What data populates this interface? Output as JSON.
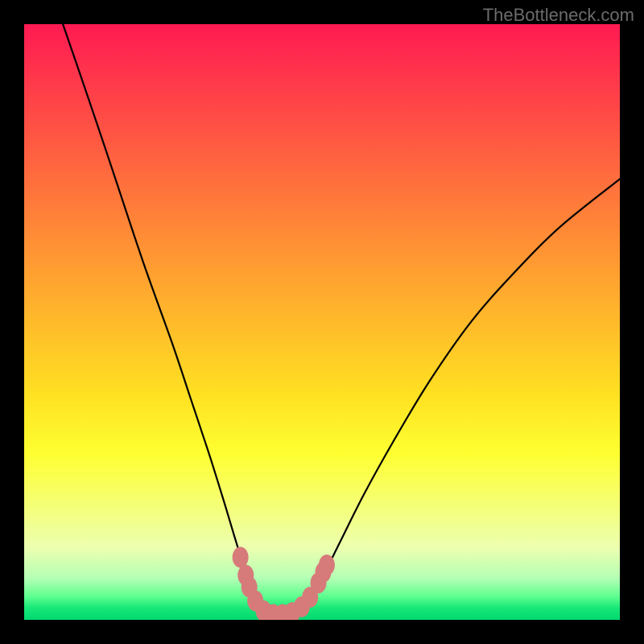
{
  "attribution": "TheBottleneck.com",
  "chart_data": {
    "type": "line",
    "title": "",
    "xlabel": "",
    "ylabel": "",
    "xlim": [
      0,
      100
    ],
    "ylim": [
      0,
      100
    ],
    "series": [
      {
        "name": "bottleneck-curve",
        "points": [
          {
            "x": 6.5,
            "y": 100
          },
          {
            "x": 10,
            "y": 90
          },
          {
            "x": 15,
            "y": 75
          },
          {
            "x": 20,
            "y": 60
          },
          {
            "x": 25,
            "y": 46
          },
          {
            "x": 28,
            "y": 37
          },
          {
            "x": 31,
            "y": 28
          },
          {
            "x": 33.5,
            "y": 20
          },
          {
            "x": 35,
            "y": 15
          },
          {
            "x": 36.5,
            "y": 10
          },
          {
            "x": 37.5,
            "y": 6
          },
          {
            "x": 38.5,
            "y": 3.5
          },
          {
            "x": 40,
            "y": 1.5
          },
          {
            "x": 42,
            "y": 0.8
          },
          {
            "x": 44,
            "y": 0.8
          },
          {
            "x": 46,
            "y": 1.5
          },
          {
            "x": 48,
            "y": 3.5
          },
          {
            "x": 50,
            "y": 7
          },
          {
            "x": 53,
            "y": 13
          },
          {
            "x": 57,
            "y": 21
          },
          {
            "x": 62,
            "y": 30
          },
          {
            "x": 68,
            "y": 40
          },
          {
            "x": 75,
            "y": 50
          },
          {
            "x": 82,
            "y": 58
          },
          {
            "x": 90,
            "y": 66
          },
          {
            "x": 100,
            "y": 74
          }
        ],
        "color": "#000000"
      },
      {
        "name": "highlight-markers",
        "points": [
          {
            "x": 36.3,
            "y": 10.5
          },
          {
            "x": 37.8,
            "y": 5.5
          },
          {
            "x": 37.2,
            "y": 7.5
          },
          {
            "x": 38.8,
            "y": 3.2
          },
          {
            "x": 40.2,
            "y": 1.5
          },
          {
            "x": 41.8,
            "y": 0.9
          },
          {
            "x": 43.4,
            "y": 0.9
          },
          {
            "x": 45.0,
            "y": 1.2
          },
          {
            "x": 46.6,
            "y": 2.2
          },
          {
            "x": 48.0,
            "y": 3.8
          },
          {
            "x": 49.4,
            "y": 6.2
          },
          {
            "x": 50.2,
            "y": 8.0
          },
          {
            "x": 50.8,
            "y": 9.2
          }
        ],
        "color": "#d77a7a"
      }
    ],
    "annotations": []
  },
  "colors": {
    "curve": "#000000",
    "markers": "#d77a7a",
    "frame": "#000000"
  }
}
